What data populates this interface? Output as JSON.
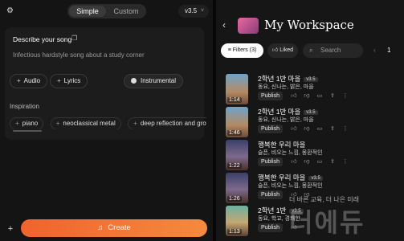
{
  "topbar": {
    "settings_icon": "gear-icon",
    "mode_simple": "Simple",
    "mode_custom": "Custom",
    "version": "v3.5",
    "version_chevron": "˅"
  },
  "describe": {
    "label": "Describe your song",
    "text": "Infectious hardstyle song about a study corner",
    "chips": {
      "audio": "Audio",
      "lyrics": "Lyrics",
      "instrumental": "Instrumental"
    }
  },
  "inspiration": {
    "label": "Inspiration",
    "tags": [
      "piano",
      "neoclassical metal",
      "deep reflection and growth"
    ]
  },
  "create": {
    "label": "Create",
    "plus": "+"
  },
  "workspace": {
    "back": "‹",
    "title": "My Workspace",
    "filter": "Filters (3)",
    "liked": "Liked",
    "search_placeholder": "Search",
    "pager_prev": "‹",
    "page": "1"
  },
  "songs": [
    {
      "title": "2학년 1반 마을",
      "version": "v3.5",
      "tags": "동요, 신나는, 밝은, 마을",
      "duration": "1:14",
      "publish": "Publish"
    },
    {
      "title": "2학년 1반 마을",
      "version": "v3.5",
      "tags": "동요, 신나는, 밝은, 마을",
      "duration": "1:46",
      "publish": "Publish"
    },
    {
      "title": "행복한 우리 마을",
      "version": "v3.5",
      "tags": "슬픈, 비오는 느낌, 몽환적인",
      "duration": "1:22",
      "publish": "Publish"
    },
    {
      "title": "행복한 우리 마을",
      "version": "v3.5",
      "tags": "슬픈, 비오는 느낌, 몽환적인",
      "duration": "1:26",
      "publish": "Publish"
    },
    {
      "title": "2학년 1반",
      "version": "v3.5",
      "tags": "동요, 학교, 경쾌한",
      "duration": "1:13",
      "publish": "Publish"
    }
  ],
  "watermark": {
    "small": "더 바른 교육, 더 나은 미래",
    "big": "더에듀"
  }
}
